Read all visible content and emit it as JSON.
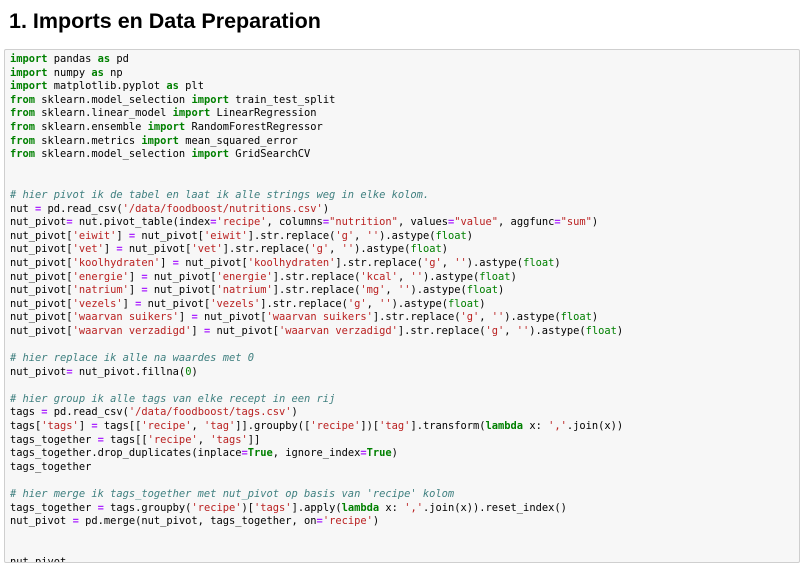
{
  "heading": "1. Imports en Data Preparation",
  "colors": {
    "keyword": "#008000",
    "string": "#ba2121",
    "comment": "#408080",
    "operator": "#aa22ff",
    "cell_background": "#f7f7f7",
    "cell_border": "#cfcfcf"
  },
  "code_lines": [
    [
      {
        "t": "import",
        "c": "kw"
      },
      {
        "t": " pandas "
      },
      {
        "t": "as",
        "c": "kw"
      },
      {
        "t": " pd"
      }
    ],
    [
      {
        "t": "import",
        "c": "kw"
      },
      {
        "t": " numpy "
      },
      {
        "t": "as",
        "c": "kw"
      },
      {
        "t": " np"
      }
    ],
    [
      {
        "t": "import",
        "c": "kw"
      },
      {
        "t": " matplotlib.pyplot "
      },
      {
        "t": "as",
        "c": "kw"
      },
      {
        "t": " plt"
      }
    ],
    [
      {
        "t": "from",
        "c": "kw"
      },
      {
        "t": " sklearn.model_selection "
      },
      {
        "t": "import",
        "c": "kw"
      },
      {
        "t": " train_test_split"
      }
    ],
    [
      {
        "t": "from",
        "c": "kw"
      },
      {
        "t": " sklearn.linear_model "
      },
      {
        "t": "import",
        "c": "kw"
      },
      {
        "t": " LinearRegression"
      }
    ],
    [
      {
        "t": "from",
        "c": "kw"
      },
      {
        "t": " sklearn.ensemble "
      },
      {
        "t": "import",
        "c": "kw"
      },
      {
        "t": " RandomForestRegressor"
      }
    ],
    [
      {
        "t": "from",
        "c": "kw"
      },
      {
        "t": " sklearn.metrics "
      },
      {
        "t": "import",
        "c": "kw"
      },
      {
        "t": " mean_squared_error"
      }
    ],
    [
      {
        "t": "from",
        "c": "kw"
      },
      {
        "t": " sklearn.model_selection "
      },
      {
        "t": "import",
        "c": "kw"
      },
      {
        "t": " GridSearchCV"
      }
    ],
    [],
    [],
    [
      {
        "t": "# hier pivot ik de tabel en laat ik alle strings weg in elke kolom.",
        "c": "cm"
      }
    ],
    [
      {
        "t": "nut "
      },
      {
        "t": "=",
        "c": "op"
      },
      {
        "t": " pd.read_csv("
      },
      {
        "t": "'/data/foodboost/nutritions.csv'",
        "c": "st"
      },
      {
        "t": ")"
      }
    ],
    [
      {
        "t": "nut_pivot"
      },
      {
        "t": "=",
        "c": "op"
      },
      {
        "t": " nut.pivot_table(index"
      },
      {
        "t": "=",
        "c": "op"
      },
      {
        "t": "'recipe'",
        "c": "st"
      },
      {
        "t": ", columns"
      },
      {
        "t": "=",
        "c": "op"
      },
      {
        "t": "\"nutrition\"",
        "c": "st"
      },
      {
        "t": ", values"
      },
      {
        "t": "=",
        "c": "op"
      },
      {
        "t": "\"value\"",
        "c": "st"
      },
      {
        "t": ", aggfunc"
      },
      {
        "t": "=",
        "c": "op"
      },
      {
        "t": "\"sum\"",
        "c": "st"
      },
      {
        "t": ")"
      }
    ],
    [
      {
        "t": "nut_pivot["
      },
      {
        "t": "'eiwit'",
        "c": "st"
      },
      {
        "t": "] "
      },
      {
        "t": "=",
        "c": "op"
      },
      {
        "t": " nut_pivot["
      },
      {
        "t": "'eiwit'",
        "c": "st"
      },
      {
        "t": "].str.replace("
      },
      {
        "t": "'g'",
        "c": "st"
      },
      {
        "t": ", "
      },
      {
        "t": "''",
        "c": "st"
      },
      {
        "t": ").astype("
      },
      {
        "t": "float",
        "c": "bi"
      },
      {
        "t": ")"
      }
    ],
    [
      {
        "t": "nut_pivot["
      },
      {
        "t": "'vet'",
        "c": "st"
      },
      {
        "t": "] "
      },
      {
        "t": "=",
        "c": "op"
      },
      {
        "t": " nut_pivot["
      },
      {
        "t": "'vet'",
        "c": "st"
      },
      {
        "t": "].str.replace("
      },
      {
        "t": "'g'",
        "c": "st"
      },
      {
        "t": ", "
      },
      {
        "t": "''",
        "c": "st"
      },
      {
        "t": ").astype("
      },
      {
        "t": "float",
        "c": "bi"
      },
      {
        "t": ")"
      }
    ],
    [
      {
        "t": "nut_pivot["
      },
      {
        "t": "'koolhydraten'",
        "c": "st"
      },
      {
        "t": "] "
      },
      {
        "t": "=",
        "c": "op"
      },
      {
        "t": " nut_pivot["
      },
      {
        "t": "'koolhydraten'",
        "c": "st"
      },
      {
        "t": "].str.replace("
      },
      {
        "t": "'g'",
        "c": "st"
      },
      {
        "t": ", "
      },
      {
        "t": "''",
        "c": "st"
      },
      {
        "t": ").astype("
      },
      {
        "t": "float",
        "c": "bi"
      },
      {
        "t": ")"
      }
    ],
    [
      {
        "t": "nut_pivot["
      },
      {
        "t": "'energie'",
        "c": "st"
      },
      {
        "t": "] "
      },
      {
        "t": "=",
        "c": "op"
      },
      {
        "t": " nut_pivot["
      },
      {
        "t": "'energie'",
        "c": "st"
      },
      {
        "t": "].str.replace("
      },
      {
        "t": "'kcal'",
        "c": "st"
      },
      {
        "t": ", "
      },
      {
        "t": "''",
        "c": "st"
      },
      {
        "t": ").astype("
      },
      {
        "t": "float",
        "c": "bi"
      },
      {
        "t": ")"
      }
    ],
    [
      {
        "t": "nut_pivot["
      },
      {
        "t": "'natrium'",
        "c": "st"
      },
      {
        "t": "] "
      },
      {
        "t": "=",
        "c": "op"
      },
      {
        "t": " nut_pivot["
      },
      {
        "t": "'natrium'",
        "c": "st"
      },
      {
        "t": "].str.replace("
      },
      {
        "t": "'mg'",
        "c": "st"
      },
      {
        "t": ", "
      },
      {
        "t": "''",
        "c": "st"
      },
      {
        "t": ").astype("
      },
      {
        "t": "float",
        "c": "bi"
      },
      {
        "t": ")"
      }
    ],
    [
      {
        "t": "nut_pivot["
      },
      {
        "t": "'vezels'",
        "c": "st"
      },
      {
        "t": "] "
      },
      {
        "t": "=",
        "c": "op"
      },
      {
        "t": " nut_pivot["
      },
      {
        "t": "'vezels'",
        "c": "st"
      },
      {
        "t": "].str.replace("
      },
      {
        "t": "'g'",
        "c": "st"
      },
      {
        "t": ", "
      },
      {
        "t": "''",
        "c": "st"
      },
      {
        "t": ").astype("
      },
      {
        "t": "float",
        "c": "bi"
      },
      {
        "t": ")"
      }
    ],
    [
      {
        "t": "nut_pivot["
      },
      {
        "t": "'waarvan suikers'",
        "c": "st"
      },
      {
        "t": "] "
      },
      {
        "t": "=",
        "c": "op"
      },
      {
        "t": " nut_pivot["
      },
      {
        "t": "'waarvan suikers'",
        "c": "st"
      },
      {
        "t": "].str.replace("
      },
      {
        "t": "'g'",
        "c": "st"
      },
      {
        "t": ", "
      },
      {
        "t": "''",
        "c": "st"
      },
      {
        "t": ").astype("
      },
      {
        "t": "float",
        "c": "bi"
      },
      {
        "t": ")"
      }
    ],
    [
      {
        "t": "nut_pivot["
      },
      {
        "t": "'waarvan verzadigd'",
        "c": "st"
      },
      {
        "t": "] "
      },
      {
        "t": "=",
        "c": "op"
      },
      {
        "t": " nut_pivot["
      },
      {
        "t": "'waarvan verzadigd'",
        "c": "st"
      },
      {
        "t": "].str.replace("
      },
      {
        "t": "'g'",
        "c": "st"
      },
      {
        "t": ", "
      },
      {
        "t": "''",
        "c": "st"
      },
      {
        "t": ").astype("
      },
      {
        "t": "float",
        "c": "bi"
      },
      {
        "t": ")"
      }
    ],
    [],
    [
      {
        "t": "# hier replace ik alle na waardes met 0",
        "c": "cm"
      }
    ],
    [
      {
        "t": "nut_pivot"
      },
      {
        "t": "=",
        "c": "op"
      },
      {
        "t": " nut_pivot.fillna("
      },
      {
        "t": "0",
        "c": "nm"
      },
      {
        "t": ")"
      }
    ],
    [],
    [
      {
        "t": "# hier group ik alle tags van elke recept in een rij",
        "c": "cm"
      }
    ],
    [
      {
        "t": "tags "
      },
      {
        "t": "=",
        "c": "op"
      },
      {
        "t": " pd.read_csv("
      },
      {
        "t": "'/data/foodboost/tags.csv'",
        "c": "st"
      },
      {
        "t": ")"
      }
    ],
    [
      {
        "t": "tags["
      },
      {
        "t": "'tags'",
        "c": "st"
      },
      {
        "t": "] "
      },
      {
        "t": "=",
        "c": "op"
      },
      {
        "t": " tags[["
      },
      {
        "t": "'recipe'",
        "c": "st"
      },
      {
        "t": ", "
      },
      {
        "t": "'tag'",
        "c": "st"
      },
      {
        "t": "]].groupby(["
      },
      {
        "t": "'recipe'",
        "c": "st"
      },
      {
        "t": "])["
      },
      {
        "t": "'tag'",
        "c": "st"
      },
      {
        "t": "].transform("
      },
      {
        "t": "lambda",
        "c": "kw"
      },
      {
        "t": " x: "
      },
      {
        "t": "','",
        "c": "st"
      },
      {
        "t": ".join(x))"
      }
    ],
    [
      {
        "t": "tags_together "
      },
      {
        "t": "=",
        "c": "op"
      },
      {
        "t": " tags[["
      },
      {
        "t": "'recipe'",
        "c": "st"
      },
      {
        "t": ", "
      },
      {
        "t": "'tags'",
        "c": "st"
      },
      {
        "t": "]]"
      }
    ],
    [
      {
        "t": "tags_together.drop_duplicates(inplace"
      },
      {
        "t": "=",
        "c": "op"
      },
      {
        "t": "True",
        "c": "kw"
      },
      {
        "t": ", ignore_index"
      },
      {
        "t": "=",
        "c": "op"
      },
      {
        "t": "True",
        "c": "kw"
      },
      {
        "t": ")"
      }
    ],
    [
      {
        "t": "tags_together"
      }
    ],
    [],
    [
      {
        "t": "# hier merge ik tags_together met nut_pivot op basis van 'recipe' kolom",
        "c": "cm"
      }
    ],
    [
      {
        "t": "tags_together "
      },
      {
        "t": "=",
        "c": "op"
      },
      {
        "t": " tags.groupby("
      },
      {
        "t": "'recipe'",
        "c": "st"
      },
      {
        "t": ")["
      },
      {
        "t": "'tags'",
        "c": "st"
      },
      {
        "t": "].apply("
      },
      {
        "t": "lambda",
        "c": "kw"
      },
      {
        "t": " x: "
      },
      {
        "t": "','",
        "c": "st"
      },
      {
        "t": ".join(x)).reset_index()"
      }
    ],
    [
      {
        "t": "nut_pivot "
      },
      {
        "t": "=",
        "c": "op"
      },
      {
        "t": " pd.merge(nut_pivot, tags_together, on"
      },
      {
        "t": "=",
        "c": "op"
      },
      {
        "t": "'recipe'",
        "c": "st"
      },
      {
        "t": ")"
      }
    ],
    [],
    [],
    [
      {
        "t": "nut_pivot"
      }
    ]
  ]
}
